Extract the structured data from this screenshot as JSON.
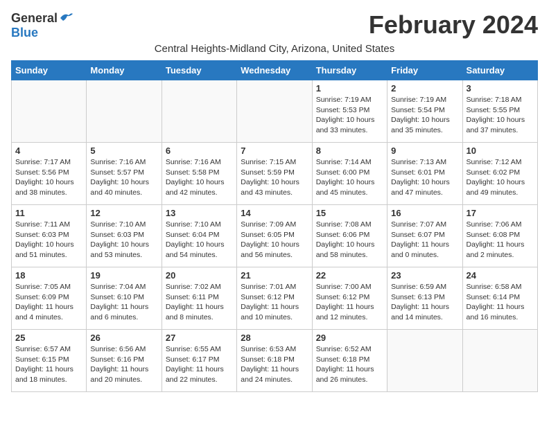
{
  "header": {
    "logo_general": "General",
    "logo_blue": "Blue",
    "month_title": "February 2024",
    "location": "Central Heights-Midland City, Arizona, United States"
  },
  "days_of_week": [
    "Sunday",
    "Monday",
    "Tuesday",
    "Wednesday",
    "Thursday",
    "Friday",
    "Saturday"
  ],
  "weeks": [
    [
      {
        "day": "",
        "info": ""
      },
      {
        "day": "",
        "info": ""
      },
      {
        "day": "",
        "info": ""
      },
      {
        "day": "",
        "info": ""
      },
      {
        "day": "1",
        "info": "Sunrise: 7:19 AM\nSunset: 5:53 PM\nDaylight: 10 hours\nand 33 minutes."
      },
      {
        "day": "2",
        "info": "Sunrise: 7:19 AM\nSunset: 5:54 PM\nDaylight: 10 hours\nand 35 minutes."
      },
      {
        "day": "3",
        "info": "Sunrise: 7:18 AM\nSunset: 5:55 PM\nDaylight: 10 hours\nand 37 minutes."
      }
    ],
    [
      {
        "day": "4",
        "info": "Sunrise: 7:17 AM\nSunset: 5:56 PM\nDaylight: 10 hours\nand 38 minutes."
      },
      {
        "day": "5",
        "info": "Sunrise: 7:16 AM\nSunset: 5:57 PM\nDaylight: 10 hours\nand 40 minutes."
      },
      {
        "day": "6",
        "info": "Sunrise: 7:16 AM\nSunset: 5:58 PM\nDaylight: 10 hours\nand 42 minutes."
      },
      {
        "day": "7",
        "info": "Sunrise: 7:15 AM\nSunset: 5:59 PM\nDaylight: 10 hours\nand 43 minutes."
      },
      {
        "day": "8",
        "info": "Sunrise: 7:14 AM\nSunset: 6:00 PM\nDaylight: 10 hours\nand 45 minutes."
      },
      {
        "day": "9",
        "info": "Sunrise: 7:13 AM\nSunset: 6:01 PM\nDaylight: 10 hours\nand 47 minutes."
      },
      {
        "day": "10",
        "info": "Sunrise: 7:12 AM\nSunset: 6:02 PM\nDaylight: 10 hours\nand 49 minutes."
      }
    ],
    [
      {
        "day": "11",
        "info": "Sunrise: 7:11 AM\nSunset: 6:03 PM\nDaylight: 10 hours\nand 51 minutes."
      },
      {
        "day": "12",
        "info": "Sunrise: 7:10 AM\nSunset: 6:03 PM\nDaylight: 10 hours\nand 53 minutes."
      },
      {
        "day": "13",
        "info": "Sunrise: 7:10 AM\nSunset: 6:04 PM\nDaylight: 10 hours\nand 54 minutes."
      },
      {
        "day": "14",
        "info": "Sunrise: 7:09 AM\nSunset: 6:05 PM\nDaylight: 10 hours\nand 56 minutes."
      },
      {
        "day": "15",
        "info": "Sunrise: 7:08 AM\nSunset: 6:06 PM\nDaylight: 10 hours\nand 58 minutes."
      },
      {
        "day": "16",
        "info": "Sunrise: 7:07 AM\nSunset: 6:07 PM\nDaylight: 11 hours\nand 0 minutes."
      },
      {
        "day": "17",
        "info": "Sunrise: 7:06 AM\nSunset: 6:08 PM\nDaylight: 11 hours\nand 2 minutes."
      }
    ],
    [
      {
        "day": "18",
        "info": "Sunrise: 7:05 AM\nSunset: 6:09 PM\nDaylight: 11 hours\nand 4 minutes."
      },
      {
        "day": "19",
        "info": "Sunrise: 7:04 AM\nSunset: 6:10 PM\nDaylight: 11 hours\nand 6 minutes."
      },
      {
        "day": "20",
        "info": "Sunrise: 7:02 AM\nSunset: 6:11 PM\nDaylight: 11 hours\nand 8 minutes."
      },
      {
        "day": "21",
        "info": "Sunrise: 7:01 AM\nSunset: 6:12 PM\nDaylight: 11 hours\nand 10 minutes."
      },
      {
        "day": "22",
        "info": "Sunrise: 7:00 AM\nSunset: 6:12 PM\nDaylight: 11 hours\nand 12 minutes."
      },
      {
        "day": "23",
        "info": "Sunrise: 6:59 AM\nSunset: 6:13 PM\nDaylight: 11 hours\nand 14 minutes."
      },
      {
        "day": "24",
        "info": "Sunrise: 6:58 AM\nSunset: 6:14 PM\nDaylight: 11 hours\nand 16 minutes."
      }
    ],
    [
      {
        "day": "25",
        "info": "Sunrise: 6:57 AM\nSunset: 6:15 PM\nDaylight: 11 hours\nand 18 minutes."
      },
      {
        "day": "26",
        "info": "Sunrise: 6:56 AM\nSunset: 6:16 PM\nDaylight: 11 hours\nand 20 minutes."
      },
      {
        "day": "27",
        "info": "Sunrise: 6:55 AM\nSunset: 6:17 PM\nDaylight: 11 hours\nand 22 minutes."
      },
      {
        "day": "28",
        "info": "Sunrise: 6:53 AM\nSunset: 6:18 PM\nDaylight: 11 hours\nand 24 minutes."
      },
      {
        "day": "29",
        "info": "Sunrise: 6:52 AM\nSunset: 6:18 PM\nDaylight: 11 hours\nand 26 minutes."
      },
      {
        "day": "",
        "info": ""
      },
      {
        "day": "",
        "info": ""
      }
    ]
  ]
}
